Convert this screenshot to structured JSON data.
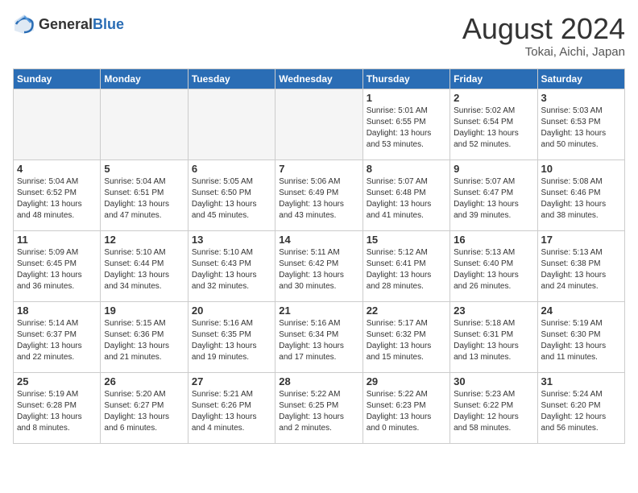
{
  "header": {
    "logo_general": "General",
    "logo_blue": "Blue",
    "month_title": "August 2024",
    "location": "Tokai, Aichi, Japan"
  },
  "weekdays": [
    "Sunday",
    "Monday",
    "Tuesday",
    "Wednesday",
    "Thursday",
    "Friday",
    "Saturday"
  ],
  "weeks": [
    [
      {
        "day": "",
        "info": ""
      },
      {
        "day": "",
        "info": ""
      },
      {
        "day": "",
        "info": ""
      },
      {
        "day": "",
        "info": ""
      },
      {
        "day": "1",
        "info": "Sunrise: 5:01 AM\nSunset: 6:55 PM\nDaylight: 13 hours\nand 53 minutes."
      },
      {
        "day": "2",
        "info": "Sunrise: 5:02 AM\nSunset: 6:54 PM\nDaylight: 13 hours\nand 52 minutes."
      },
      {
        "day": "3",
        "info": "Sunrise: 5:03 AM\nSunset: 6:53 PM\nDaylight: 13 hours\nand 50 minutes."
      }
    ],
    [
      {
        "day": "4",
        "info": "Sunrise: 5:04 AM\nSunset: 6:52 PM\nDaylight: 13 hours\nand 48 minutes."
      },
      {
        "day": "5",
        "info": "Sunrise: 5:04 AM\nSunset: 6:51 PM\nDaylight: 13 hours\nand 47 minutes."
      },
      {
        "day": "6",
        "info": "Sunrise: 5:05 AM\nSunset: 6:50 PM\nDaylight: 13 hours\nand 45 minutes."
      },
      {
        "day": "7",
        "info": "Sunrise: 5:06 AM\nSunset: 6:49 PM\nDaylight: 13 hours\nand 43 minutes."
      },
      {
        "day": "8",
        "info": "Sunrise: 5:07 AM\nSunset: 6:48 PM\nDaylight: 13 hours\nand 41 minutes."
      },
      {
        "day": "9",
        "info": "Sunrise: 5:07 AM\nSunset: 6:47 PM\nDaylight: 13 hours\nand 39 minutes."
      },
      {
        "day": "10",
        "info": "Sunrise: 5:08 AM\nSunset: 6:46 PM\nDaylight: 13 hours\nand 38 minutes."
      }
    ],
    [
      {
        "day": "11",
        "info": "Sunrise: 5:09 AM\nSunset: 6:45 PM\nDaylight: 13 hours\nand 36 minutes."
      },
      {
        "day": "12",
        "info": "Sunrise: 5:10 AM\nSunset: 6:44 PM\nDaylight: 13 hours\nand 34 minutes."
      },
      {
        "day": "13",
        "info": "Sunrise: 5:10 AM\nSunset: 6:43 PM\nDaylight: 13 hours\nand 32 minutes."
      },
      {
        "day": "14",
        "info": "Sunrise: 5:11 AM\nSunset: 6:42 PM\nDaylight: 13 hours\nand 30 minutes."
      },
      {
        "day": "15",
        "info": "Sunrise: 5:12 AM\nSunset: 6:41 PM\nDaylight: 13 hours\nand 28 minutes."
      },
      {
        "day": "16",
        "info": "Sunrise: 5:13 AM\nSunset: 6:40 PM\nDaylight: 13 hours\nand 26 minutes."
      },
      {
        "day": "17",
        "info": "Sunrise: 5:13 AM\nSunset: 6:38 PM\nDaylight: 13 hours\nand 24 minutes."
      }
    ],
    [
      {
        "day": "18",
        "info": "Sunrise: 5:14 AM\nSunset: 6:37 PM\nDaylight: 13 hours\nand 22 minutes."
      },
      {
        "day": "19",
        "info": "Sunrise: 5:15 AM\nSunset: 6:36 PM\nDaylight: 13 hours\nand 21 minutes."
      },
      {
        "day": "20",
        "info": "Sunrise: 5:16 AM\nSunset: 6:35 PM\nDaylight: 13 hours\nand 19 minutes."
      },
      {
        "day": "21",
        "info": "Sunrise: 5:16 AM\nSunset: 6:34 PM\nDaylight: 13 hours\nand 17 minutes."
      },
      {
        "day": "22",
        "info": "Sunrise: 5:17 AM\nSunset: 6:32 PM\nDaylight: 13 hours\nand 15 minutes."
      },
      {
        "day": "23",
        "info": "Sunrise: 5:18 AM\nSunset: 6:31 PM\nDaylight: 13 hours\nand 13 minutes."
      },
      {
        "day": "24",
        "info": "Sunrise: 5:19 AM\nSunset: 6:30 PM\nDaylight: 13 hours\nand 11 minutes."
      }
    ],
    [
      {
        "day": "25",
        "info": "Sunrise: 5:19 AM\nSunset: 6:28 PM\nDaylight: 13 hours\nand 8 minutes."
      },
      {
        "day": "26",
        "info": "Sunrise: 5:20 AM\nSunset: 6:27 PM\nDaylight: 13 hours\nand 6 minutes."
      },
      {
        "day": "27",
        "info": "Sunrise: 5:21 AM\nSunset: 6:26 PM\nDaylight: 13 hours\nand 4 minutes."
      },
      {
        "day": "28",
        "info": "Sunrise: 5:22 AM\nSunset: 6:25 PM\nDaylight: 13 hours\nand 2 minutes."
      },
      {
        "day": "29",
        "info": "Sunrise: 5:22 AM\nSunset: 6:23 PM\nDaylight: 13 hours\nand 0 minutes."
      },
      {
        "day": "30",
        "info": "Sunrise: 5:23 AM\nSunset: 6:22 PM\nDaylight: 12 hours\nand 58 minutes."
      },
      {
        "day": "31",
        "info": "Sunrise: 5:24 AM\nSunset: 6:20 PM\nDaylight: 12 hours\nand 56 minutes."
      }
    ]
  ]
}
